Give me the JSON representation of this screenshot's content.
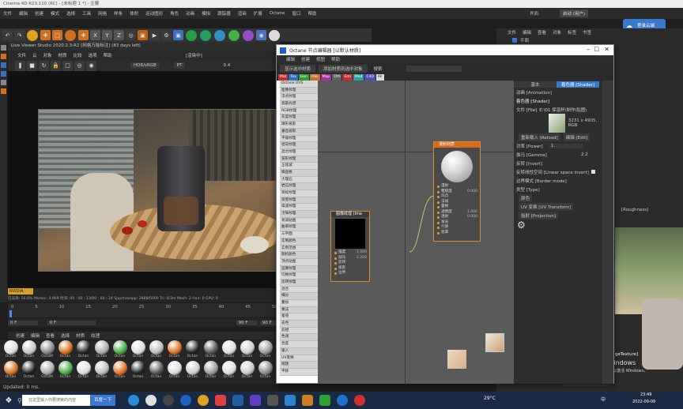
{
  "app": {
    "title_bar": "Cinema 4D R23.110 (RC) - [未标题 1 *] - 主要",
    "menu": [
      "文件",
      "编辑",
      "创建",
      "模式",
      "选择",
      "工具",
      "网格",
      "样条",
      "体积",
      "运动图形",
      "角色",
      "动画",
      "模拟",
      "跟踪器",
      "渲染",
      "扩展",
      "Octane",
      "窗口",
      "帮助"
    ],
    "layout_label": "界面:",
    "layout_value": "启动 (用户)",
    "cloud_button": "登录云端"
  },
  "viewer": {
    "title": "Live Viewer Studio 2020.2.3-R2 [网格万能标注] (83 days left)",
    "menu": [
      "文件",
      "云",
      "对象",
      "材质",
      "比较",
      "选项",
      "帮助"
    ],
    "tag": "[渲染中]",
    "color_mode": "HDR/sRGB",
    "pt_label": "PT",
    "value": "0.4",
    "status": "已渲染: 56.6%  Ms/sec: 4.969  时间: 00 : 00 : 13/00 : 00 : 24  Spp/maxspp: 2888/5000  Tri: 0/3m  Mesh: 2  Hair: 0  GPU: 0",
    "nvidia_label": "NVIDIA"
  },
  "timeline": {
    "ticks": [
      "0",
      "5",
      "10",
      "15",
      "20",
      "25",
      "30",
      "35",
      "40",
      "45",
      "50"
    ],
    "start_field": "0 F",
    "current_field": "0 F",
    "end_field": "90 F",
    "end_field2": "90 F"
  },
  "materials": {
    "menu": [
      "创建",
      "编辑",
      "查看",
      "选择",
      "材质",
      "纹理"
    ],
    "labels": [
      "Octan",
      "Octan",
      "OctaM",
      "Octan",
      "Octan",
      "Octan",
      "Octan",
      "Octan",
      "Octan",
      "Octan",
      "Octan",
      "Octan",
      "Octan",
      "Octan",
      "Octan"
    ]
  },
  "status_bar": "Updated: 0 ms.",
  "right_panel": {
    "menu": [
      "文件",
      "编辑",
      "查看",
      "对象",
      "标签",
      "书签"
    ],
    "object_name": "平面",
    "roughness_tag": "[Roughness]",
    "texture_tag": "geTexture]",
    "win_activate": "激活 Windows",
    "win_activate_sub": "转到“设置”以激活 Windows。",
    "percent": "0 %"
  },
  "octane_editor": {
    "title": "Octane 节点编辑器 [以默认材质]",
    "menu": [
      "编辑",
      "创建",
      "视图",
      "帮助"
    ],
    "btn_select_mat": "显示选中材质",
    "btn_add_to_mat": "添加材质到选中对象",
    "btn_search": "搜索",
    "categories": [
      "Mat",
      "Tex",
      "Gen",
      "OSL",
      "Map",
      "Oth",
      "Emi",
      "Med",
      "C4D",
      "All"
    ],
    "node_list": [
      "Octane UVS",
      "图像纹理",
      "浮点纹理",
      "高斯光谱",
      "RGB纹理",
      "灰度纹理",
      "球形投影",
      "垂直投影",
      "平铺纹理",
      "径向纹理",
      "混合纹理",
      "波形纹理",
      "正弦波",
      "棋盘格",
      "大理石",
      "岩石纹理",
      "目标纹理",
      "渐变纹理",
      "噪波纹理",
      "污垢纹理",
      "衰减贴图",
      "曲率纹理",
      "三平面",
      "实例颜色",
      "实例范围",
      "随机颜色",
      "顶点贴图",
      "运算纹理",
      "切换纹理",
      "反转纹理",
      "混合",
      "细分",
      "叠加",
      "乘法",
      "差值",
      "去色",
      "反相",
      "色调",
      "亮度",
      "输入",
      "UV变换",
      "缩放",
      "平移",
      "角度"
    ],
    "list_footer1": "实例颜色(Clone",
    "list_footer2": "Octane 对象颜色",
    "node_diffuse": {
      "title": "漫射材质",
      "inputs": [
        "漫射",
        "粗糙度",
        "凹凸",
        "法线",
        "置换",
        "透明度",
        "透射",
        "发光",
        "介质",
        "遮罩"
      ],
      "values": [
        "",
        "0.000",
        "",
        "",
        "",
        "1.000",
        "0.000",
        "",
        "",
        ""
      ]
    },
    "node_image": {
      "title": "图像纹理 (Ima",
      "inputs": [
        "强度",
        "伽马",
        "反转",
        "投影",
        "边界"
      ],
      "values": [
        "1.000",
        "2.200",
        "",
        "",
        ""
      ]
    },
    "props": {
      "tab_basic": "基本",
      "tab_shader": "着色器 [Shader]",
      "anim_tab": "动画 [Animation]",
      "shader_heading": "着色器 [Shader]",
      "file_label": "文件 [File]",
      "file_value": "E:\\01 保温杯\\制作\\贴图\\",
      "resolution": "3231 x 4905, RGB",
      "reload_btn": "重新载入 [Reload]",
      "edit_btn": "编辑 [Edit]",
      "power_label": "功率 [Power]",
      "power_value": "1.",
      "gamma_label": "伽马 [Gamma]",
      "gamma_value": "2.2",
      "invert_label": "反转 [Invert]",
      "linear_label": "反转线性空间 [Linear space invert]",
      "border_label": "边界模式 [Border mode]",
      "type_label": "类型 [Type]",
      "color_btn": "颜色",
      "uv_btn": "UV 变换 [UV Transform]",
      "proj_btn": "投射 [Projection]"
    }
  },
  "taskbar": {
    "search_placeholder": "在这里输入你要搜索的内容",
    "search_btn": "百度一下",
    "weather": "29°C",
    "ime": "中",
    "time": "23:49",
    "date": "2022-09-09"
  },
  "colors": {
    "accent": "#3a78d0",
    "node_header": "#d86a1e",
    "node_border": "#e08a2a"
  }
}
